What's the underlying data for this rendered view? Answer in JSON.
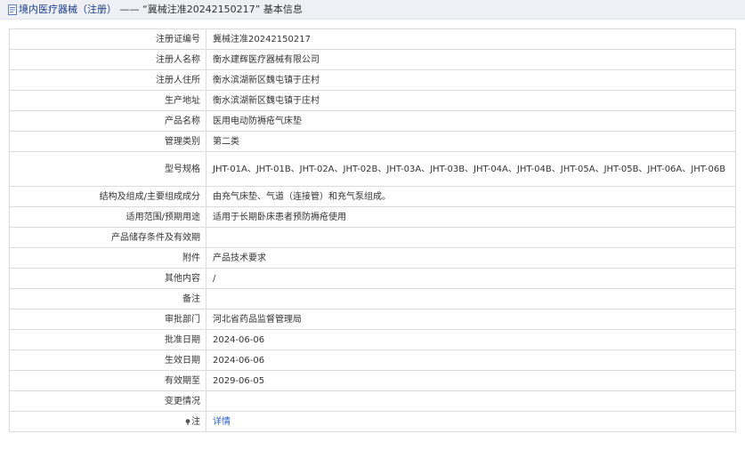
{
  "header": {
    "title_main": "境内医疗器械（注册）",
    "title_rest": " —— “冀械注准20242150217” 基本信息",
    "icon": "document-icon"
  },
  "rows": [
    {
      "label": "注册证编号",
      "value": "冀械注准20242150217"
    },
    {
      "label": "注册人名称",
      "value": "衡水建辉医疗器械有限公司"
    },
    {
      "label": "注册人住所",
      "value": "衡水滨湖新区魏屯镇于庄村"
    },
    {
      "label": "生产地址",
      "value": "衡水滨湖新区魏屯镇于庄村"
    },
    {
      "label": "产品名称",
      "value": "医用电动防褥疮气床垫"
    },
    {
      "label": "管理类别",
      "value": "第二类"
    },
    {
      "label": "型号规格",
      "value": "JHT-01A、JHT-01B、JHT-02A、JHT-02B、JHT-03A、JHT-03B、JHT-04A、JHT-04B、JHT-05A、JHT-05B、JHT-06A、JHT-06B"
    },
    {
      "label": "结构及组成/主要组成成分",
      "value": "由充气床垫、气道（连接管）和充气泵组成。"
    },
    {
      "label": "适用范围/预期用途",
      "value": "适用于长期卧床患者预防褥疮使用"
    },
    {
      "label": "产品储存条件及有效期",
      "value": ""
    },
    {
      "label": "附件",
      "value": "产品技术要求"
    },
    {
      "label": "其他内容",
      "value": "/"
    },
    {
      "label": "备注",
      "value": ""
    },
    {
      "label": "审批部门",
      "value": "河北省药品监督管理局"
    },
    {
      "label": "批准日期",
      "value": "2024-06-06"
    },
    {
      "label": "生效日期",
      "value": "2024-06-06"
    },
    {
      "label": "有效期至",
      "value": "2029-06-05"
    },
    {
      "label": "变更情况",
      "value": ""
    }
  ],
  "note_row": {
    "label": "注",
    "icon": "note-icon",
    "link_text": "详情"
  }
}
